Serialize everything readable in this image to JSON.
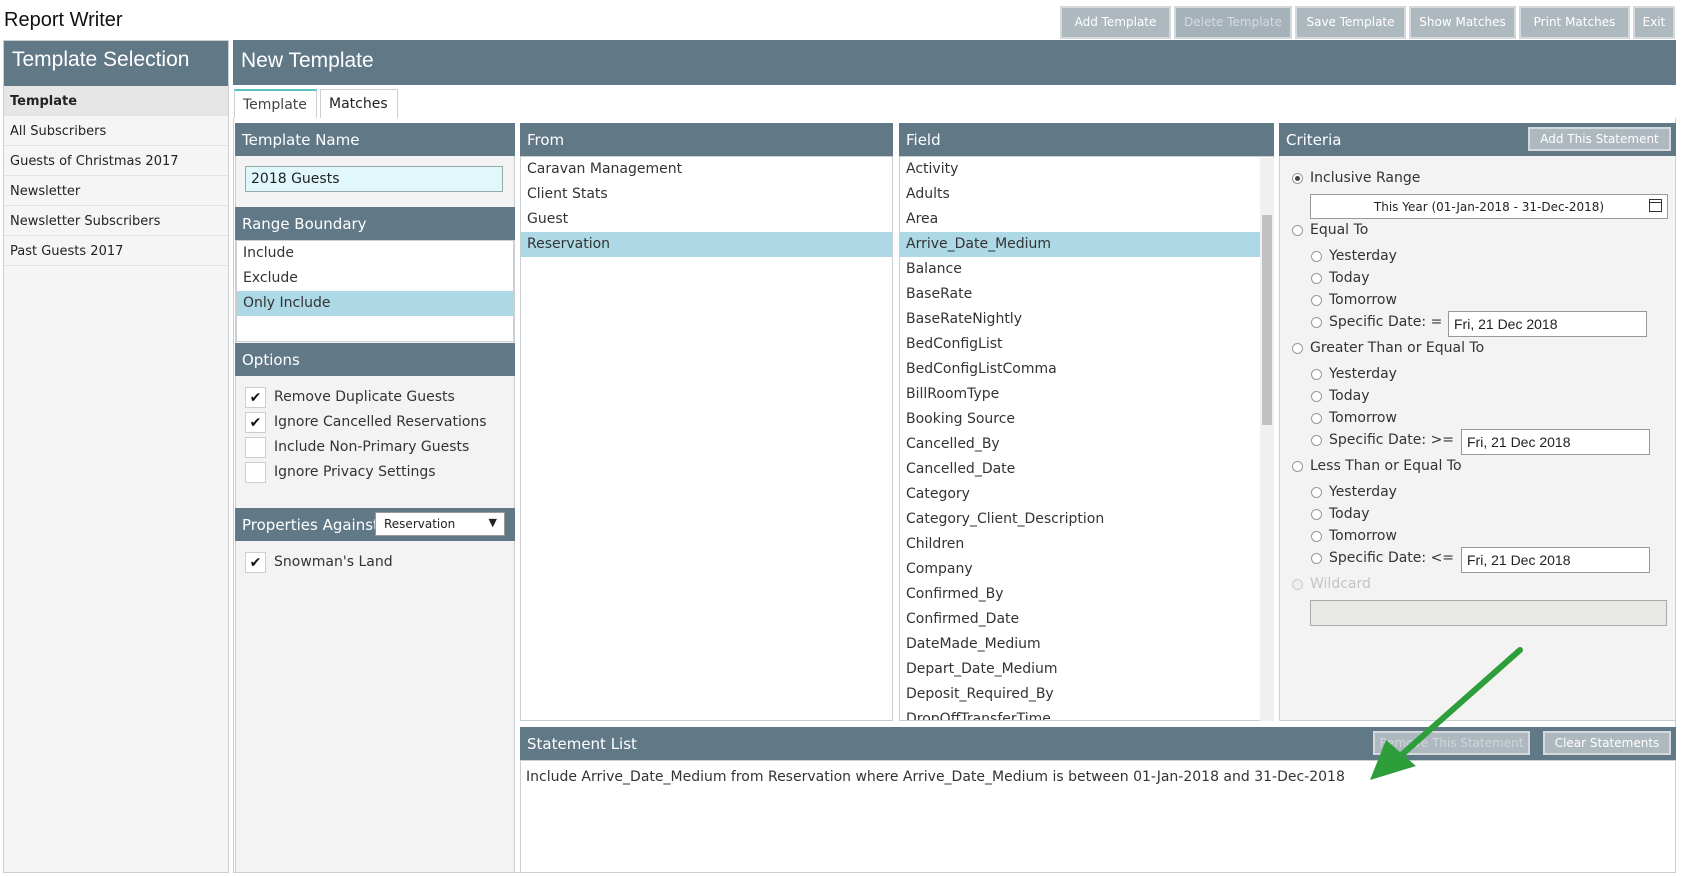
{
  "app_title": "Report Writer",
  "sidebar": {
    "title": "Template Selection",
    "items": [
      {
        "label": "Template",
        "active": true
      },
      {
        "label": "All Subscribers"
      },
      {
        "label": "Guests of Christmas 2017"
      },
      {
        "label": "Newsletter"
      },
      {
        "label": "Newsletter Subscribers"
      },
      {
        "label": "Past Guests 2017"
      }
    ]
  },
  "header": {
    "title": "New Template",
    "buttons": {
      "add": "Add Template",
      "delete": "Delete Template",
      "save": "Save Template",
      "show": "Show Matches",
      "print": "Print Matches",
      "exit": "Exit"
    }
  },
  "tabs": [
    "Template",
    "Matches"
  ],
  "template_name": {
    "title": "Template Name",
    "value": "2018 Guests"
  },
  "range_boundary": {
    "title": "Range Boundary",
    "items": [
      "Include",
      "Exclude",
      "Only Include"
    ],
    "selected": "Only Include"
  },
  "options": {
    "title": "Options",
    "items": [
      {
        "label": "Remove Duplicate Guests",
        "checked": true
      },
      {
        "label": "Ignore Cancelled Reservations",
        "checked": true
      },
      {
        "label": "Include Non-Primary Guests",
        "checked": false
      },
      {
        "label": "Ignore Privacy Settings",
        "checked": false
      }
    ]
  },
  "properties": {
    "title": "Properties Against",
    "select_value": "Reservation",
    "items": [
      {
        "label": "Snowman's Land",
        "checked": true
      }
    ]
  },
  "from": {
    "title": "From",
    "items": [
      "Caravan Management",
      "Client Stats",
      "Guest",
      "Reservation"
    ],
    "selected": "Reservation"
  },
  "field": {
    "title": "Field",
    "items": [
      "Activity",
      "Adults",
      "Area",
      "Arrive_Date_Medium",
      "Balance",
      "BaseRate",
      "BaseRateNightly",
      "BedConfigList",
      "BedConfigListComma",
      "BillRoomType",
      "Booking Source",
      "Cancelled_By",
      "Cancelled_Date",
      "Category",
      "Category_Client_Description",
      "Children",
      "Company",
      "Confirmed_By",
      "Confirmed_Date",
      "DateMade_Medium",
      "Depart_Date_Medium",
      "Deposit_Required_By",
      "DropOffTransferTime"
    ],
    "selected": "Arrive_Date_Medium"
  },
  "criteria": {
    "title": "Criteria",
    "add_button": "Add This Statement",
    "inclusive_range": "Inclusive Range",
    "range_value": "This Year (01-Jan-2018 - 31-Dec-2018)",
    "equal_to": "Equal To",
    "gte": "Greater Than or Equal To",
    "lte": "Less Than or Equal To",
    "wildcard": "Wildcard",
    "yesterday": "Yesterday",
    "today": "Today",
    "tomorrow": "Tomorrow",
    "specific_eq": "Specific Date: =",
    "specific_gte": "Specific Date: >=",
    "specific_lte": "Specific Date: <=",
    "date_value": "Fri, 21 Dec 2018"
  },
  "statement_list": {
    "title": "Statement List",
    "remove_button": "Remove This Statement",
    "clear_button": "Clear Statements",
    "statement": "Include Arrive_Date_Medium from Reservation where Arrive_Date_Medium is between 01-Jan-2018 and 31-Dec-2018"
  },
  "colors": {
    "header": "#617987",
    "selected": "#add8e6",
    "annotation_arrow": "#2e9e3a"
  },
  "icons": {
    "calendar": "calendar-icon",
    "dropdown": "chevron-down-icon",
    "check": "check-icon"
  }
}
